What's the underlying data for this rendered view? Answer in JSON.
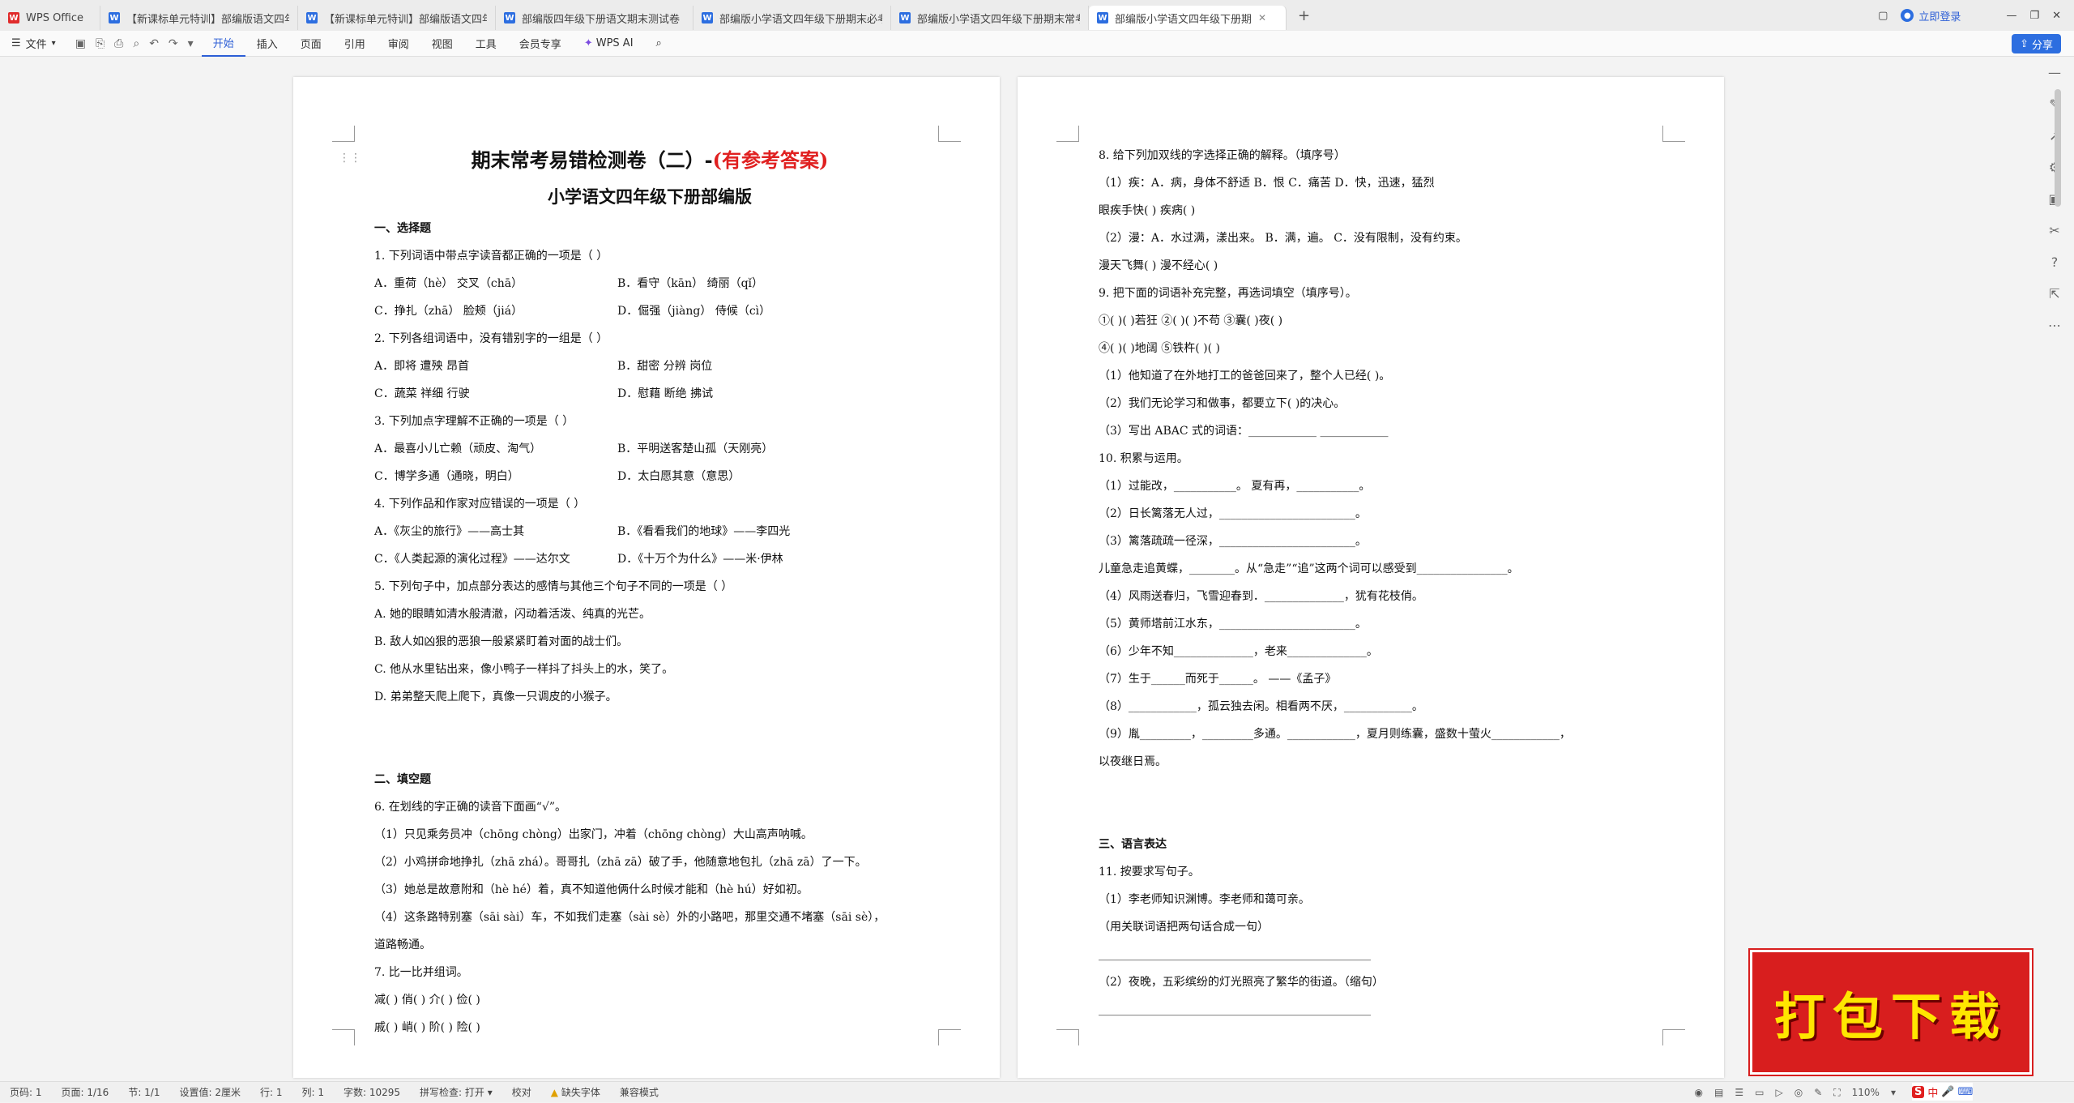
{
  "tabs": [
    {
      "label": "WPS Office",
      "icon": "wps-logo-icon"
    },
    {
      "label": "【新课标单元特训】部编版语文四年"
    },
    {
      "label": "【新课标单元特训】部编版语文四年"
    },
    {
      "label": "部编版四年级下册语文期末测试卷"
    },
    {
      "label": "部编版小学语文四年级下册期末必考"
    },
    {
      "label": "部编版小学语文四年级下册期末常考"
    },
    {
      "label": "部编版小学语文四年级下册期"
    }
  ],
  "tabbar": {
    "login": "立即登录",
    "new_tab": "+"
  },
  "menubar": {
    "file": "文件",
    "items": [
      "开始",
      "插入",
      "页面",
      "引用",
      "审阅",
      "视图",
      "工具",
      "会员专享"
    ],
    "wps_ai": "WPS AI",
    "share": "分享"
  },
  "page1": {
    "title_black": "期末常考易错检测卷（二）-",
    "title_red": "(有参考答案)",
    "subtitle": "小学语文四年级下册部编版",
    "lines": [
      "一、选择题",
      "1. 下列词语中带点字读音都正确的一项是（      ）",
      [
        "A．重荷（hè）        交叉（chā）",
        "B．看守（kān）        绮丽（qǐ）"
      ],
      [
        "C．挣扎（zhā）        脸颊（jiá）",
        "D．倔强（jiàng）        侍候（cì）"
      ],
      "2. 下列各组词语中，没有错别字的一组是（      ）",
      [
        "A．即将  遭殃  昂首",
        "B．甜密  分辨  岗位"
      ],
      [
        "C．蔬菜  祥细  行驶",
        "D．慰藉  断绝  拂试"
      ],
      "3. 下列加点字理解不正确的一项是（      ）",
      [
        "A．最喜小儿亡赖（顽皮、淘气）",
        "B．平明送客楚山孤（天刚亮）"
      ],
      [
        "C．博学多通（通晓，明白）",
        "D．太白愿其意（意思）"
      ],
      "4. 下列作品和作家对应错误的一项是（      ）",
      [
        "A．《灰尘的旅行》——高士其",
        "B．《看看我们的地球》——李四光"
      ],
      [
        "C．《人类起源的演化过程》——达尔文",
        "D．《十万个为什么》——米·伊林"
      ],
      "5. 下列句子中，加点部分表达的感情与其他三个句子不同的一项是（      ）",
      "A. 她的眼睛如清水般清澈，闪动着活泼、纯真的光芒。",
      "B. 敌人如凶狠的恶狼一般紧紧盯着对面的战士们。",
      "C. 他从水里钻出来，像小鸭子一样抖了抖头上的水，笑了。",
      "D. 弟弟整天爬上爬下，真像一只调皮的小猴子。",
      "",
      "",
      "二、填空题",
      "6. 在划线的字正确的读音下面画“√”。",
      "（1）只见乘务员冲（chōng  chòng）出家门，冲着（chōng  chòng）大山高声呐喊。",
      "（2）小鸡拼命地挣扎（zhā  zhá）。哥哥扎（zhā  zā）破了手，他随意地包扎（zhā  zā）了一下。",
      "（3）她总是故意附和（hè  hé）着，真不知道他俩什么时候才能和（hè  hú）好如初。",
      "（4）这条路特别塞（sāi  sài）车，不如我们走塞（sài  sè）外的小路吧，那里交通不堵塞（sāi  sè），",
      "道路畅通。",
      "7. 比一比并组词。",
      "减(          )     俏(          )     介(              )     俭(            )",
      "戚(          )     峭(          )     阶(              )     险(            )"
    ]
  },
  "page2": {
    "lines": [
      "8. 给下列加双线的字选择正确的解释。（填序号）",
      "（1）疾：A．病，身体不舒适  B．恨  C．痛苦  D．快，迅速，猛烈",
      "眼疾手快(            )    疾病(            )",
      "（2）漫：A．水过满，漾出来。  B．满，遍。  C．没有限制，没有约束。",
      "漫天飞舞(            )    漫不经心(            )",
      "9. 把下面的词语补充完整，再选词填空（填序号）。",
      "①(        )(        )若狂   ②(        )(        )不苟   ③囊(        )夜(        )",
      "④(        )(        )地阔   ⑤铁杵(        )(        )",
      "（1）他知道了在外地打工的爸爸回来了，整个人已经(          )。",
      "（2）我们无论学习和做事，都要立下(        )的决心。",
      "（3）写出 ABAC 式的词语：____________    ____________",
      "10. 积累与运用。",
      "（1）过能改，___________。  夏有再，___________。",
      "（2）日长篱落无人过，________________________。",
      "（3）篱落疏疏一径深，________________________。",
      "儿童急走追黄蝶，________。从“急走”“追”这两个词可以感受到________________。",
      "（4）风雨送春归，飞雪迎春到．______________，犹有花枝俏。",
      "（5）黄师塔前江水东，________________________。",
      "（6）少年不知______________，老来______________。",
      "（7）生于______而死于______。  ——《孟子》",
      "（8）____________，孤云独去闲。相看两不厌，____________。",
      "（9）胤_________，_________多通。____________，夏月则练囊，盛数十萤火____________，",
      "以夜继日焉。",
      "",
      "",
      "三、语言表达",
      "11. 按要求写句子。",
      "（1）李老师知识渊博。李老师和蔼可亲。",
      "（用关联词语把两句话合成一句）",
      "________________________________________________",
      "（2）夜晚，五彩缤纷的灯光照亮了繁华的街道。（缩句）",
      "________________________________________________"
    ]
  },
  "statusbar": {
    "page": "页码: 1",
    "pages": "页面: 1/16",
    "section": "节: 1/1",
    "setting": "设置值: 2厘米",
    "row": "行: 1",
    "col": "列: 1",
    "words": "字数: 10295",
    "spell": "拼写检查: 打开",
    "proof": "校对",
    "font_missing": "缺失字体",
    "compat": "兼容模式",
    "zoom": "110%"
  },
  "banner": {
    "text": "打包下载"
  },
  "ime": {
    "label": "中"
  }
}
